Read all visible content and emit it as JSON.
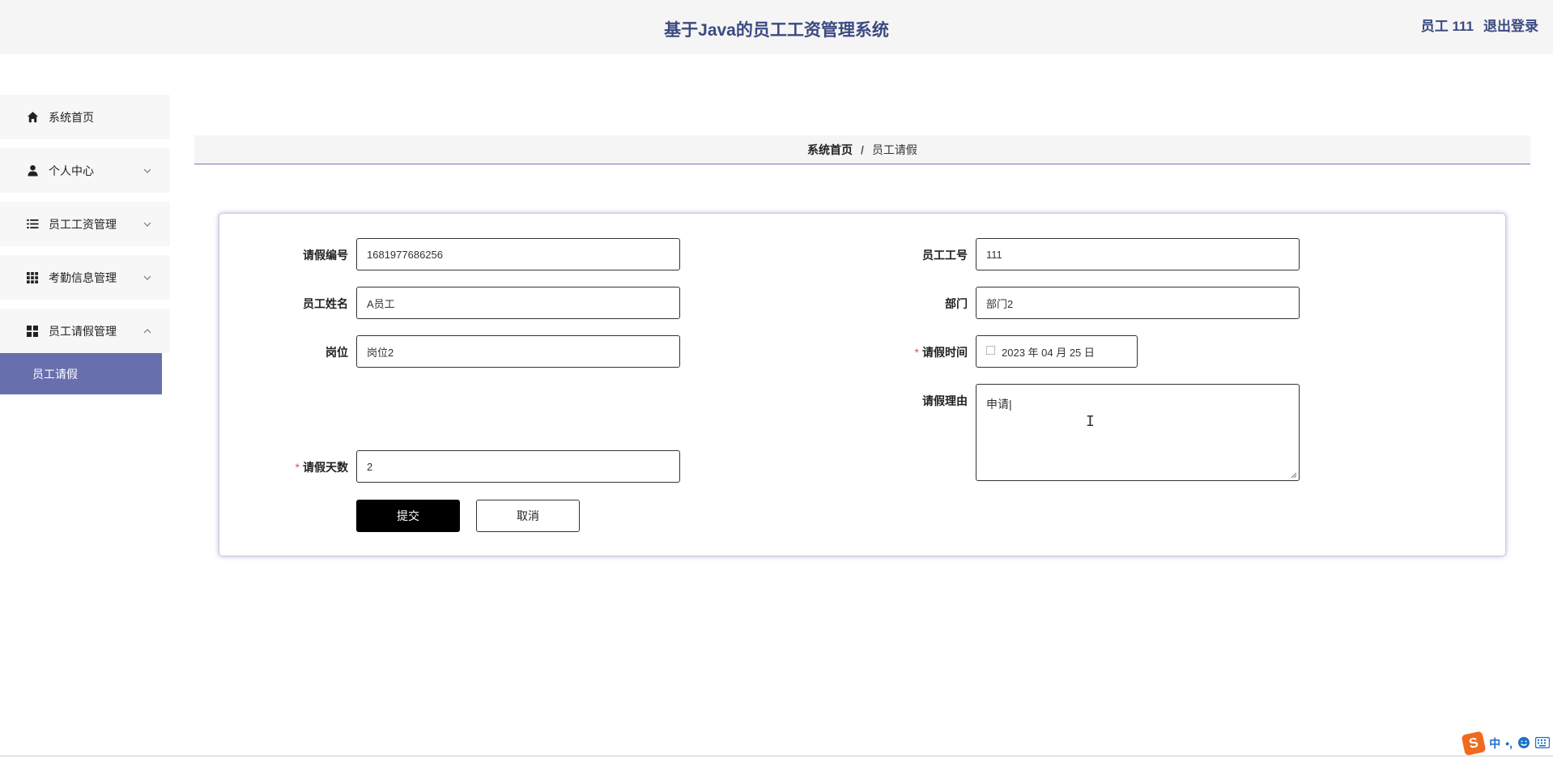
{
  "header": {
    "title": "基于Java的员工工资管理系统",
    "user": "员工 111",
    "logout": "退出登录"
  },
  "sidebar": {
    "items": [
      {
        "label": "系统首页",
        "icon": "home-icon"
      },
      {
        "label": "个人中心",
        "icon": "user-icon",
        "expandable": true
      },
      {
        "label": "员工工资管理",
        "icon": "list-icon",
        "expandable": true
      },
      {
        "label": "考勤信息管理",
        "icon": "grid-icon",
        "expandable": true
      },
      {
        "label": "员工请假管理",
        "icon": "dashboard-icon",
        "expandable": true,
        "expanded": true
      }
    ],
    "sub_items": [
      {
        "label": "员工请假",
        "active": true
      }
    ]
  },
  "breadcrumb": {
    "home": "系统首页",
    "separator": "/",
    "current": "员工请假"
  },
  "form": {
    "leave_no": {
      "label": "请假编号",
      "value": "1681977686256"
    },
    "employee_no": {
      "label": "员工工号",
      "value": "111"
    },
    "employee_name": {
      "label": "员工姓名",
      "value": "A员工"
    },
    "department": {
      "label": "部门",
      "value": "部门2"
    },
    "position": {
      "label": "岗位",
      "value": "岗位2"
    },
    "leave_time": {
      "label": "请假时间",
      "value": "2023 年 04 月 25 日",
      "required": "*"
    },
    "leave_reason": {
      "label": "请假理由",
      "value": "申请|"
    },
    "leave_days": {
      "label": "请假天数",
      "value": "2",
      "required": "*"
    },
    "submit_label": "提交",
    "cancel_label": "取消"
  },
  "ime": {
    "logo": "S",
    "mode": "中",
    "punct": "•,"
  },
  "colors": {
    "accent": "#6770ad",
    "title": "#3b4a82",
    "required": "#e05555"
  }
}
